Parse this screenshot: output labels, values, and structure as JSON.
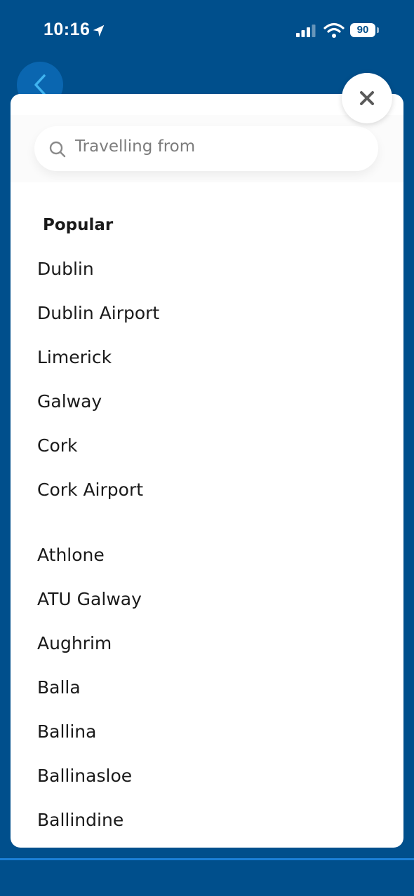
{
  "status_bar": {
    "time": "10:16",
    "battery": "90"
  },
  "search": {
    "placeholder": "Travelling from"
  },
  "popular": {
    "title": "Popular",
    "items": [
      "Dublin",
      "Dublin Airport",
      "Limerick",
      "Galway",
      "Cork",
      "Cork Airport"
    ]
  },
  "all_stops": {
    "items": [
      "Athlone",
      "ATU Galway",
      "Aughrim",
      "Balla",
      "Ballina",
      "Ballinasloe",
      "Ballindine"
    ]
  }
}
